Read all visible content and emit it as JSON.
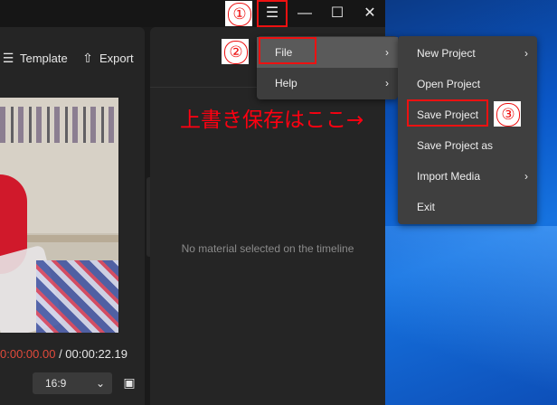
{
  "titlebar": {
    "menu_icon": "hamburger-icon",
    "minimize_icon": "minimize-icon",
    "maximize_icon": "maximize-icon",
    "close_icon": "close-icon"
  },
  "toolbar": {
    "template_label": "Template",
    "template_icon": "layers-icon",
    "export_label": "Export",
    "export_icon": "upload-icon"
  },
  "player": {
    "current_time": "0:00:00.00",
    "separator": " / ",
    "total_time": "00:00:22.19",
    "aspect_ratio": "16:9",
    "fit_icon": "fit-screen-icon"
  },
  "properties_panel": {
    "empty_message": "No material selected on the timeline"
  },
  "main_menu": {
    "items": [
      {
        "label": "File",
        "has_submenu": true
      },
      {
        "label": "Help",
        "has_submenu": true
      }
    ]
  },
  "file_submenu": {
    "items": [
      {
        "label": "New Project",
        "has_submenu": true
      },
      {
        "label": "Open Project",
        "has_submenu": false
      },
      {
        "label": "Save Project",
        "has_submenu": false
      },
      {
        "label": "Save Project as",
        "has_submenu": false
      },
      {
        "label": "Import Media",
        "has_submenu": true
      },
      {
        "label": "Exit",
        "has_submenu": false
      }
    ]
  },
  "annotations": {
    "step1": "①",
    "step2": "②",
    "step3": "③",
    "note": "上書き保存はここ→",
    "highlight_color": "#ee1111"
  },
  "colors": {
    "desktop_blue": "#0a57c8",
    "timecode_red": "#e24a3b",
    "app_bg": "#1a1a1a"
  }
}
